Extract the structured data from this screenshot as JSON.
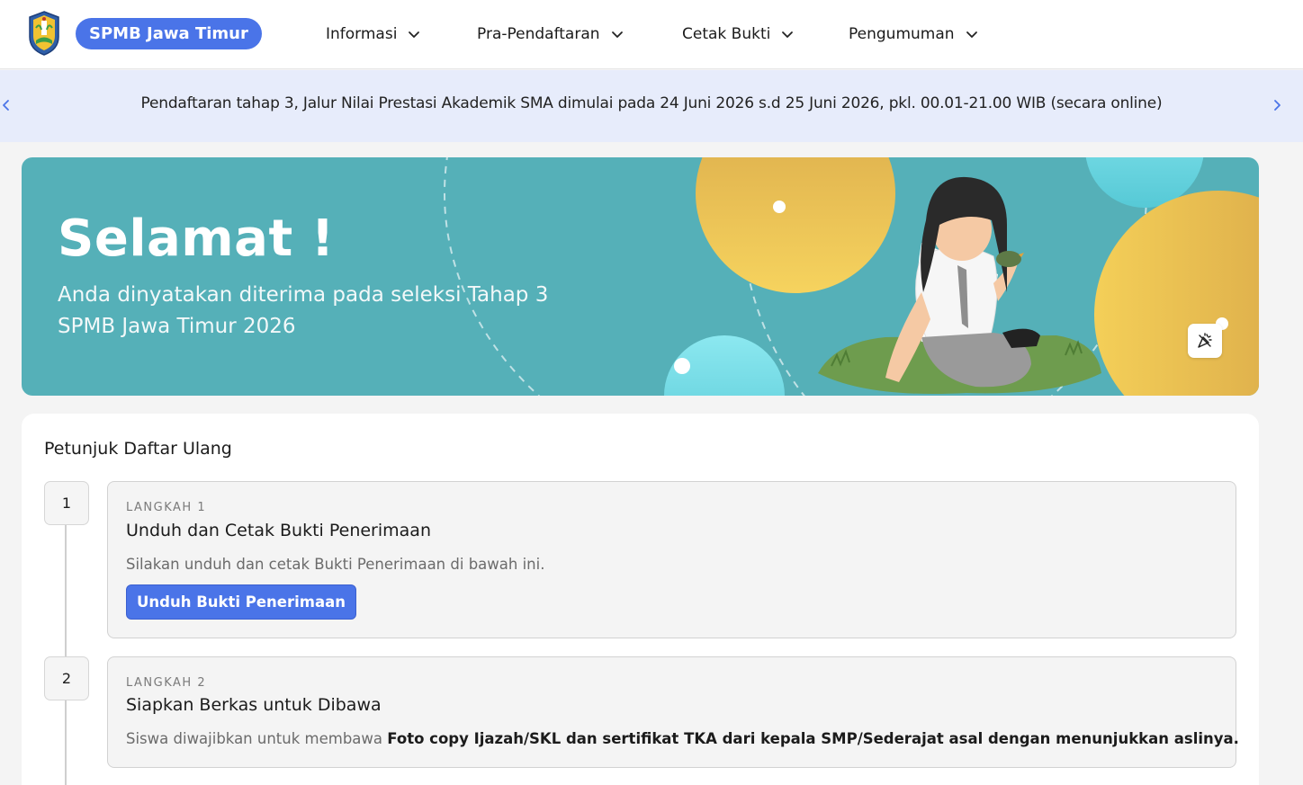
{
  "header": {
    "brand": "SPMB Jawa Timur",
    "nav": [
      {
        "label": "Informasi",
        "icon": "chevron-down-icon"
      },
      {
        "label": "Pra-Pendaftaran",
        "icon": "chevron-down-icon"
      },
      {
        "label": "Cetak Bukti",
        "icon": "chevron-down-icon"
      },
      {
        "label": "Pengumuman",
        "icon": "chevron-down-icon"
      }
    ]
  },
  "announcement": {
    "text": "Pendaftaran tahap 3, Jalur Nilai Prestasi Akademik SMA dimulai pada 24 Juni 2026 s.d 25 Juni 2026, pkl. 00.01-21.00 WIB (secara online)"
  },
  "hero": {
    "title": "Selamat !",
    "subtitle_line1": "Anda dinyatakan diterima pada seleksi Tahap 3",
    "subtitle_line2": "SPMB Jawa Timur 2026",
    "colors": {
      "background": "#55b0b8",
      "accent_yellow": "#f2c44f",
      "accent_cyan": "#7fe0ea"
    }
  },
  "guide": {
    "title": "Petunjuk Daftar Ulang",
    "steps": [
      {
        "number": "1",
        "kicker": "LANGKAH 1",
        "title": "Unduh dan Cetak Bukti Penerimaan",
        "desc": "Silakan unduh dan cetak Bukti Penerimaan di bawah ini.",
        "button": "Unduh Bukti Penerimaan"
      },
      {
        "number": "2",
        "kicker": "LANGKAH 2",
        "title": "Siapkan Berkas untuk Dibawa",
        "desc_plain": "Siswa diwajibkan untuk membawa ",
        "desc_bold": "Foto copy Ijazah/SKL dan sertifikat TKA dari kepala SMP/Sederajat asal dengan menunjukkan aslinya."
      }
    ]
  },
  "colors": {
    "primary": "#4a74e8",
    "announce_bg": "#e7ecfb",
    "page_bg": "#f4f4f4"
  }
}
